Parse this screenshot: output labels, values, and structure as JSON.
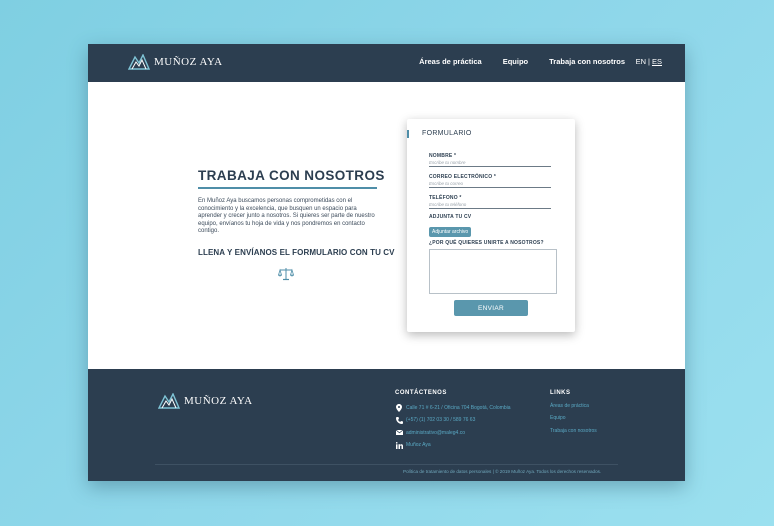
{
  "brand": {
    "name": "MUÑOZ AYA"
  },
  "nav": {
    "items": [
      "Áreas de práctica",
      "Equipo",
      "Trabaja con nosotros"
    ],
    "lang_en": "EN",
    "lang_sep": "|",
    "lang_es": "ES"
  },
  "intro": {
    "title": "TRABAJA CON NOSOTROS",
    "paragraph": "En Muñoz Aya buscamos personas comprometidas con el conocimiento y la excelencia, que busquen un espacio para aprender y crecer junto a nosotros. Si quieres ser parte de nuestro equipo, envíanos tu hoja de vida y nos pondremos en contacto contigo.",
    "subtitle": "LLENA Y ENVÍANOS EL FORMULARIO CON TU CV",
    "icon": "scales-of-justice-icon"
  },
  "form": {
    "title": "FORMULARIO",
    "name_label": "NOMBRE *",
    "name_placeholder": "Escribe tu nombre",
    "email_label": "CORREO ELECTRÓNICO *",
    "email_placeholder": "Escribe tu correo",
    "phone_label": "TELÉFONO *",
    "phone_placeholder": "Escribe tu teléfono",
    "cv_label": "ADJUNTA TU CV",
    "attach_button": "Adjuntar archivo",
    "why_label": "¿POR QUÉ QUIERES UNIRTE A NOSOTROS?",
    "submit": "ENVIAR"
  },
  "footer": {
    "contact_title": "CONTÁCTENOS",
    "contacts": [
      {
        "icon": "location-pin-icon",
        "text": "Calle 71 # 6-21 / Oficina 704 Bogotá, Colombia"
      },
      {
        "icon": "phone-icon",
        "text": "(+57) (1) 702 03 30 / 589 76 63"
      },
      {
        "icon": "mail-icon",
        "text": "administrativo@maleg4.co"
      },
      {
        "icon": "linkedin-icon",
        "text": "Muñoz Aya"
      }
    ],
    "links_title": "LINKS",
    "links": [
      "Áreas de práctica",
      "Equipo",
      "Trabaja con nosotros"
    ],
    "legal": "Política de tratamiento de datos personales  | © 2019 Muñoz Aya. Todos los derechos reservados."
  },
  "colors": {
    "navy": "#2c3e50",
    "accent": "#5a97ad",
    "link": "#5aa9c4",
    "background": "#8fd7ea"
  }
}
